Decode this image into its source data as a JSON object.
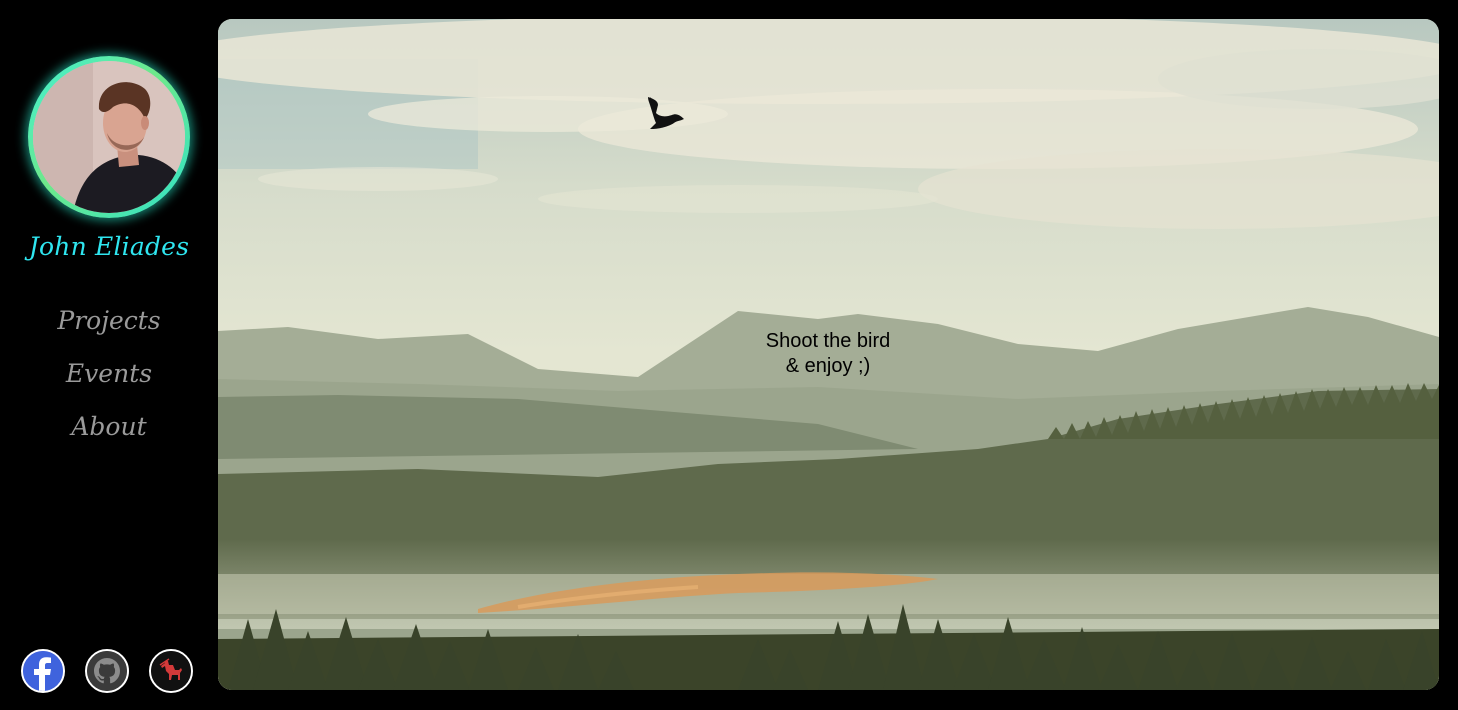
{
  "profile": {
    "name": "John Eliades",
    "avatar_icon": "portrait-photo",
    "ring_color": "#3ff0d6"
  },
  "nav": {
    "items": [
      {
        "label": "Projects"
      },
      {
        "label": "Events"
      },
      {
        "label": "About"
      }
    ]
  },
  "socials": [
    {
      "icon": "facebook-icon",
      "color": "#3b5bd6"
    },
    {
      "icon": "github-icon",
      "color": "#3a3a3a"
    },
    {
      "icon": "centaur-icon",
      "color": "#d23a3a"
    }
  ],
  "hero": {
    "background": "misty-mountain-forest-landscape",
    "bird_icon": "bird-icon",
    "message_line1": "Shoot the bird",
    "message_line2": "& enjoy ;)"
  },
  "colors": {
    "accent_name": "#2fe6f0",
    "nav_text": "#9a9a9a",
    "page_background": "#000000"
  }
}
